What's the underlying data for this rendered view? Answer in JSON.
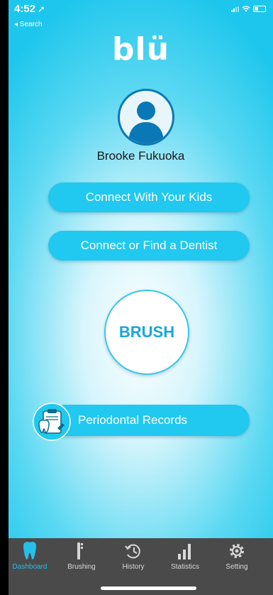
{
  "status_bar": {
    "time": "4:52",
    "back_label": "◂ Search"
  },
  "logo": "blü",
  "user": {
    "name": "Brooke Fukuoka"
  },
  "buttons": {
    "connect_kids": "Connect With Your Kids",
    "connect_dentist": "Connect or Find a Dentist",
    "brush": "BRUSH",
    "periodontal_records": "Periodontal Records"
  },
  "tabs": [
    {
      "label": "Dashboard",
      "icon": "tooth-icon",
      "active": true
    },
    {
      "label": "Brushing",
      "icon": "toothbrush-icon",
      "active": false
    },
    {
      "label": "History",
      "icon": "history-icon",
      "active": false
    },
    {
      "label": "Statistics",
      "icon": "bar-chart-icon",
      "active": false
    },
    {
      "label": "Setting",
      "icon": "gear-icon",
      "active": false
    }
  ],
  "colors": {
    "accent": "#21c8ef",
    "avatar_ring": "#0a78b6",
    "tabbar": "#4a4a4a",
    "active_tab": "#26bfe8"
  }
}
